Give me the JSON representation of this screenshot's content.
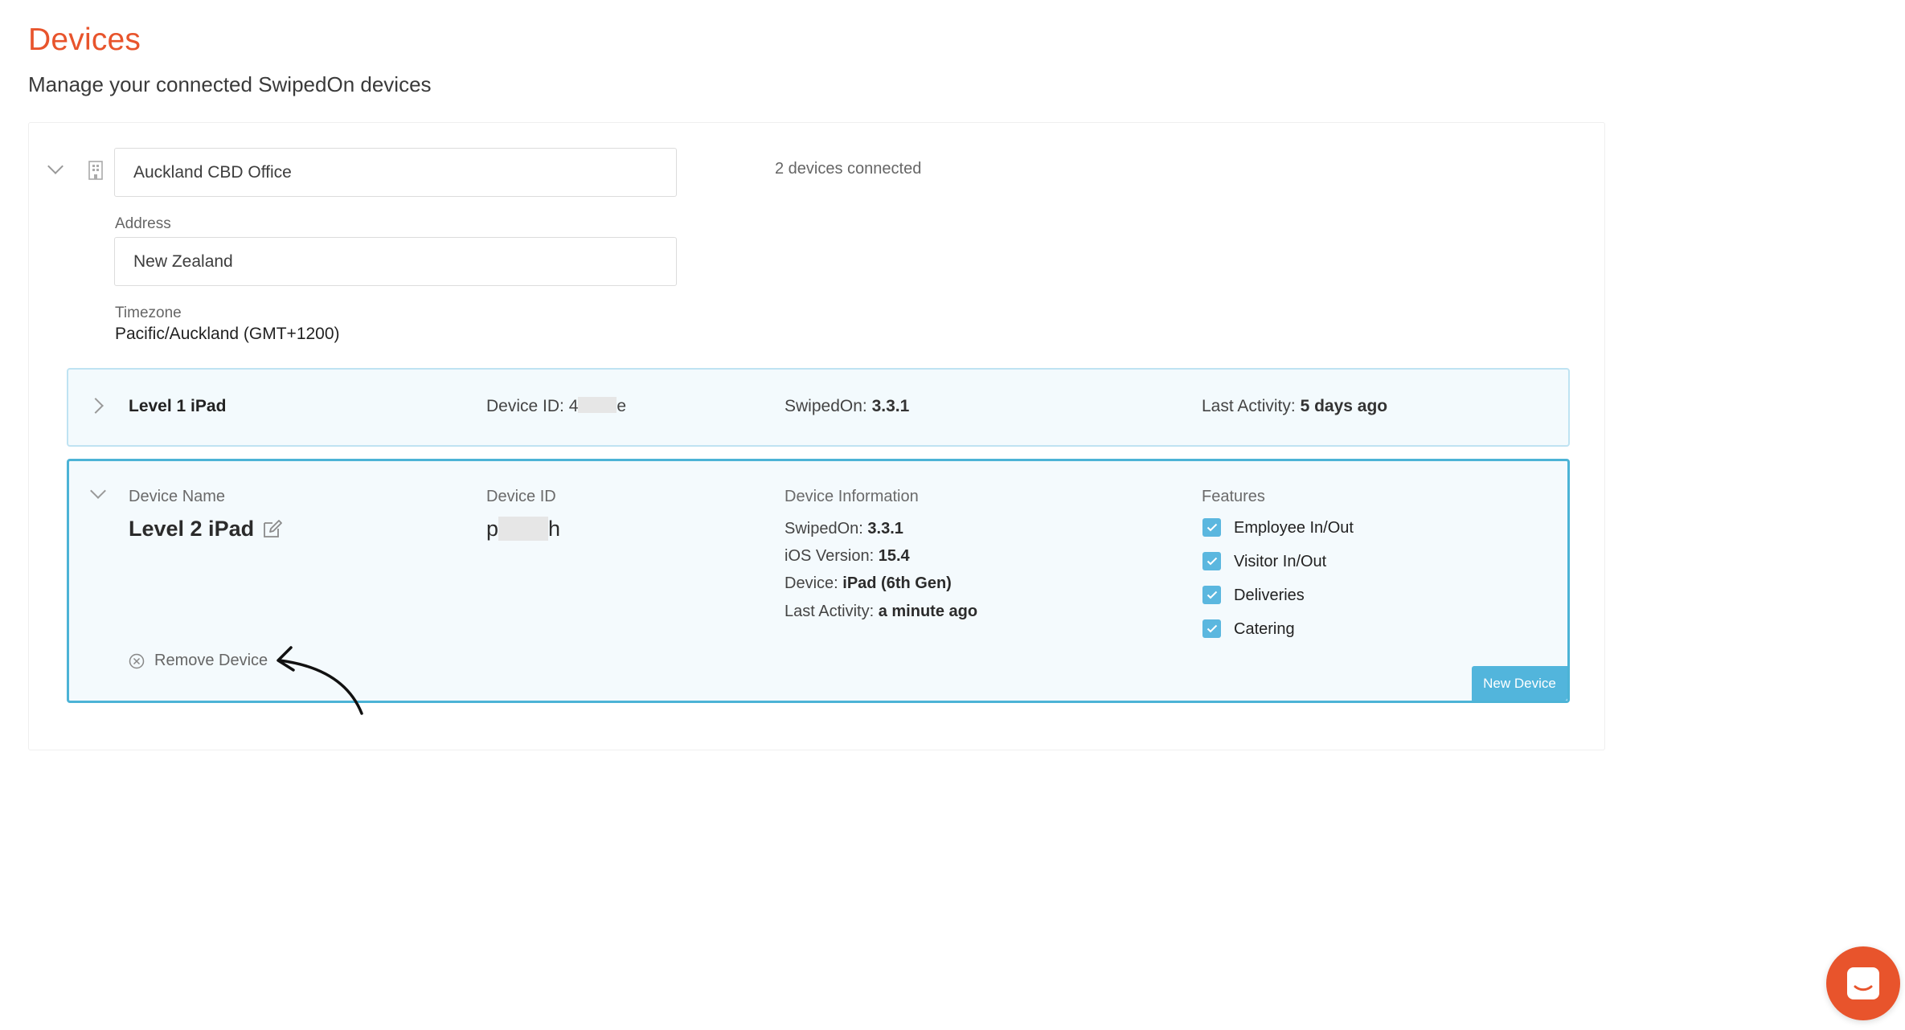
{
  "page": {
    "title": "Devices",
    "subtitle": "Manage your connected SwipedOn devices"
  },
  "location": {
    "name": "Auckland CBD Office",
    "devices_connected": "2 devices connected",
    "address_label": "Address",
    "address_value": "New Zealand",
    "timezone_label": "Timezone",
    "timezone_value": "Pacific/Auckland (GMT+1200)"
  },
  "device_row": {
    "name": "Level 1 iPad",
    "device_id_label": "Device ID:",
    "device_id_start": "4",
    "device_id_end": "e",
    "swipedon_label": "SwipedOn:",
    "swipedon_value": "3.3.1",
    "last_activity_label": "Last Activity:",
    "last_activity_value": "5 days ago"
  },
  "device_panel": {
    "device_name_label": "Device Name",
    "device_name_value": "Level 2 iPad",
    "device_id_label": "Device ID",
    "device_id_start": "p",
    "device_id_end": "h",
    "device_info_label": "Device Information",
    "info": {
      "swipedon_label": "SwipedOn:",
      "swipedon_value": "3.3.1",
      "ios_label": "iOS Version:",
      "ios_value": "15.4",
      "device_label": "Device:",
      "device_value": "iPad (6th Gen)",
      "last_activity_label": "Last Activity:",
      "last_activity_value": "a minute ago"
    },
    "features_label": "Features",
    "features": [
      {
        "label": "Employee In/Out",
        "checked": true
      },
      {
        "label": "Visitor In/Out",
        "checked": true
      },
      {
        "label": "Deliveries",
        "checked": true
      },
      {
        "label": "Catering",
        "checked": true
      }
    ],
    "remove_label": "Remove Device",
    "new_device_badge": "New Device"
  },
  "icons": {
    "collapse": "chevron-down-icon",
    "expand": "chevron-right-icon",
    "building": "building-icon",
    "edit": "edit-icon",
    "remove": "remove-circle-icon",
    "annotation": "annotation-arrow",
    "chat": "chat-icon"
  },
  "colors": {
    "brand": "#e8542c",
    "accent": "#4cb3d6",
    "checkbox": "#5bb7df"
  }
}
